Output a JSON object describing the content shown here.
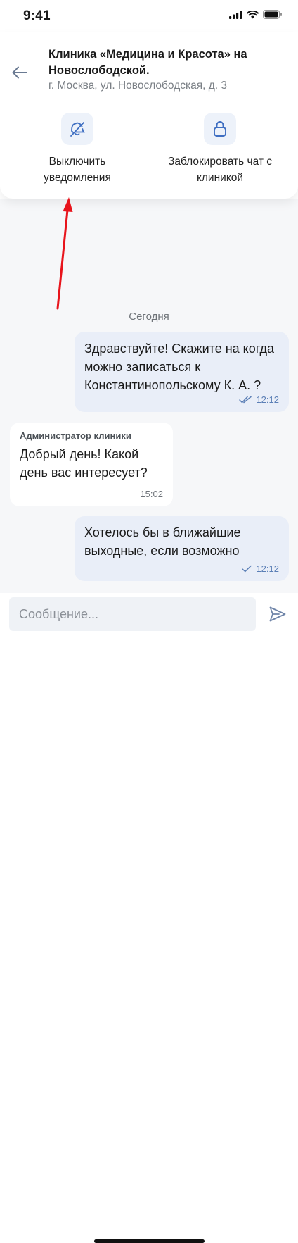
{
  "status_bar": {
    "time": "9:41"
  },
  "header": {
    "clinic_name": "Клиника «Медицина и Красота» на Новослободской.",
    "address": "г. Москва, ул. Новослободская, д. 3"
  },
  "actions": {
    "mute_label": "Выключить уведомления",
    "block_label": "Заблокировать чат с клиникой"
  },
  "chat": {
    "date_separator": "Сегодня",
    "messages": [
      {
        "direction": "outgoing",
        "text": "Здравствуйте! Скажите на когда можно записаться к Константинопольскому К. А. ?",
        "time": "12:12",
        "status": "read"
      },
      {
        "direction": "incoming",
        "sender": "Администратор клиники",
        "text": "Добрый день! Какой день вас интересует?",
        "time": "15:02"
      },
      {
        "direction": "outgoing",
        "text": "Хотелось бы в ближайшие выходные, если возможно",
        "time": "12:12",
        "status": "sent"
      }
    ]
  },
  "composer": {
    "placeholder": "Сообщение..."
  },
  "colors": {
    "accent": "#4a78c2",
    "annotation": "#e8141c",
    "outgoing_bubble": "#e9eef8"
  },
  "icons": [
    "back-arrow-icon",
    "bell-off-icon",
    "lock-icon",
    "double-check-icon",
    "check-icon",
    "send-icon"
  ]
}
